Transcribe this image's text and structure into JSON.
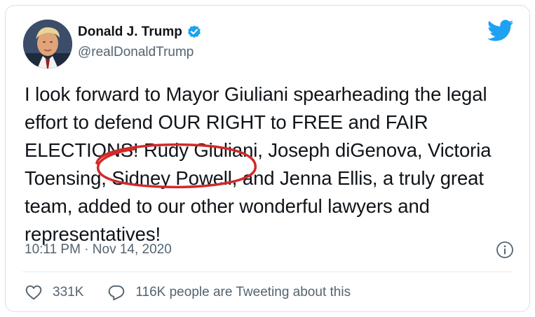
{
  "author": {
    "display_name": "Donald J. Trump",
    "handle": "@realDonaldTrump",
    "verified": true
  },
  "tweet": {
    "text": "I look forward to Mayor Giuliani spearheading the legal effort to defend OUR RIGHT to FREE and FAIR ELECTIONS! Rudy Giuliani, Joseph diGenova, Victoria Toensing, Sidney Powell, and Jenna Ellis, a truly great team, added to our other wonderful lawyers and representatives!",
    "timestamp": "10:11 PM · Nov 14, 2020"
  },
  "engagement": {
    "likes": "331K",
    "conversation": "116K people are Tweeting about this"
  },
  "icons": {
    "brand": "twitter-bird-icon",
    "verified": "verified-badge-icon",
    "info": "info-icon",
    "like": "heart-icon",
    "reply": "speech-bubble-icon"
  },
  "colors": {
    "brand_blue": "#1da1f2",
    "annotation_red": "#d12a2a",
    "secondary_text": "#536471",
    "primary_text": "#0f1419"
  }
}
